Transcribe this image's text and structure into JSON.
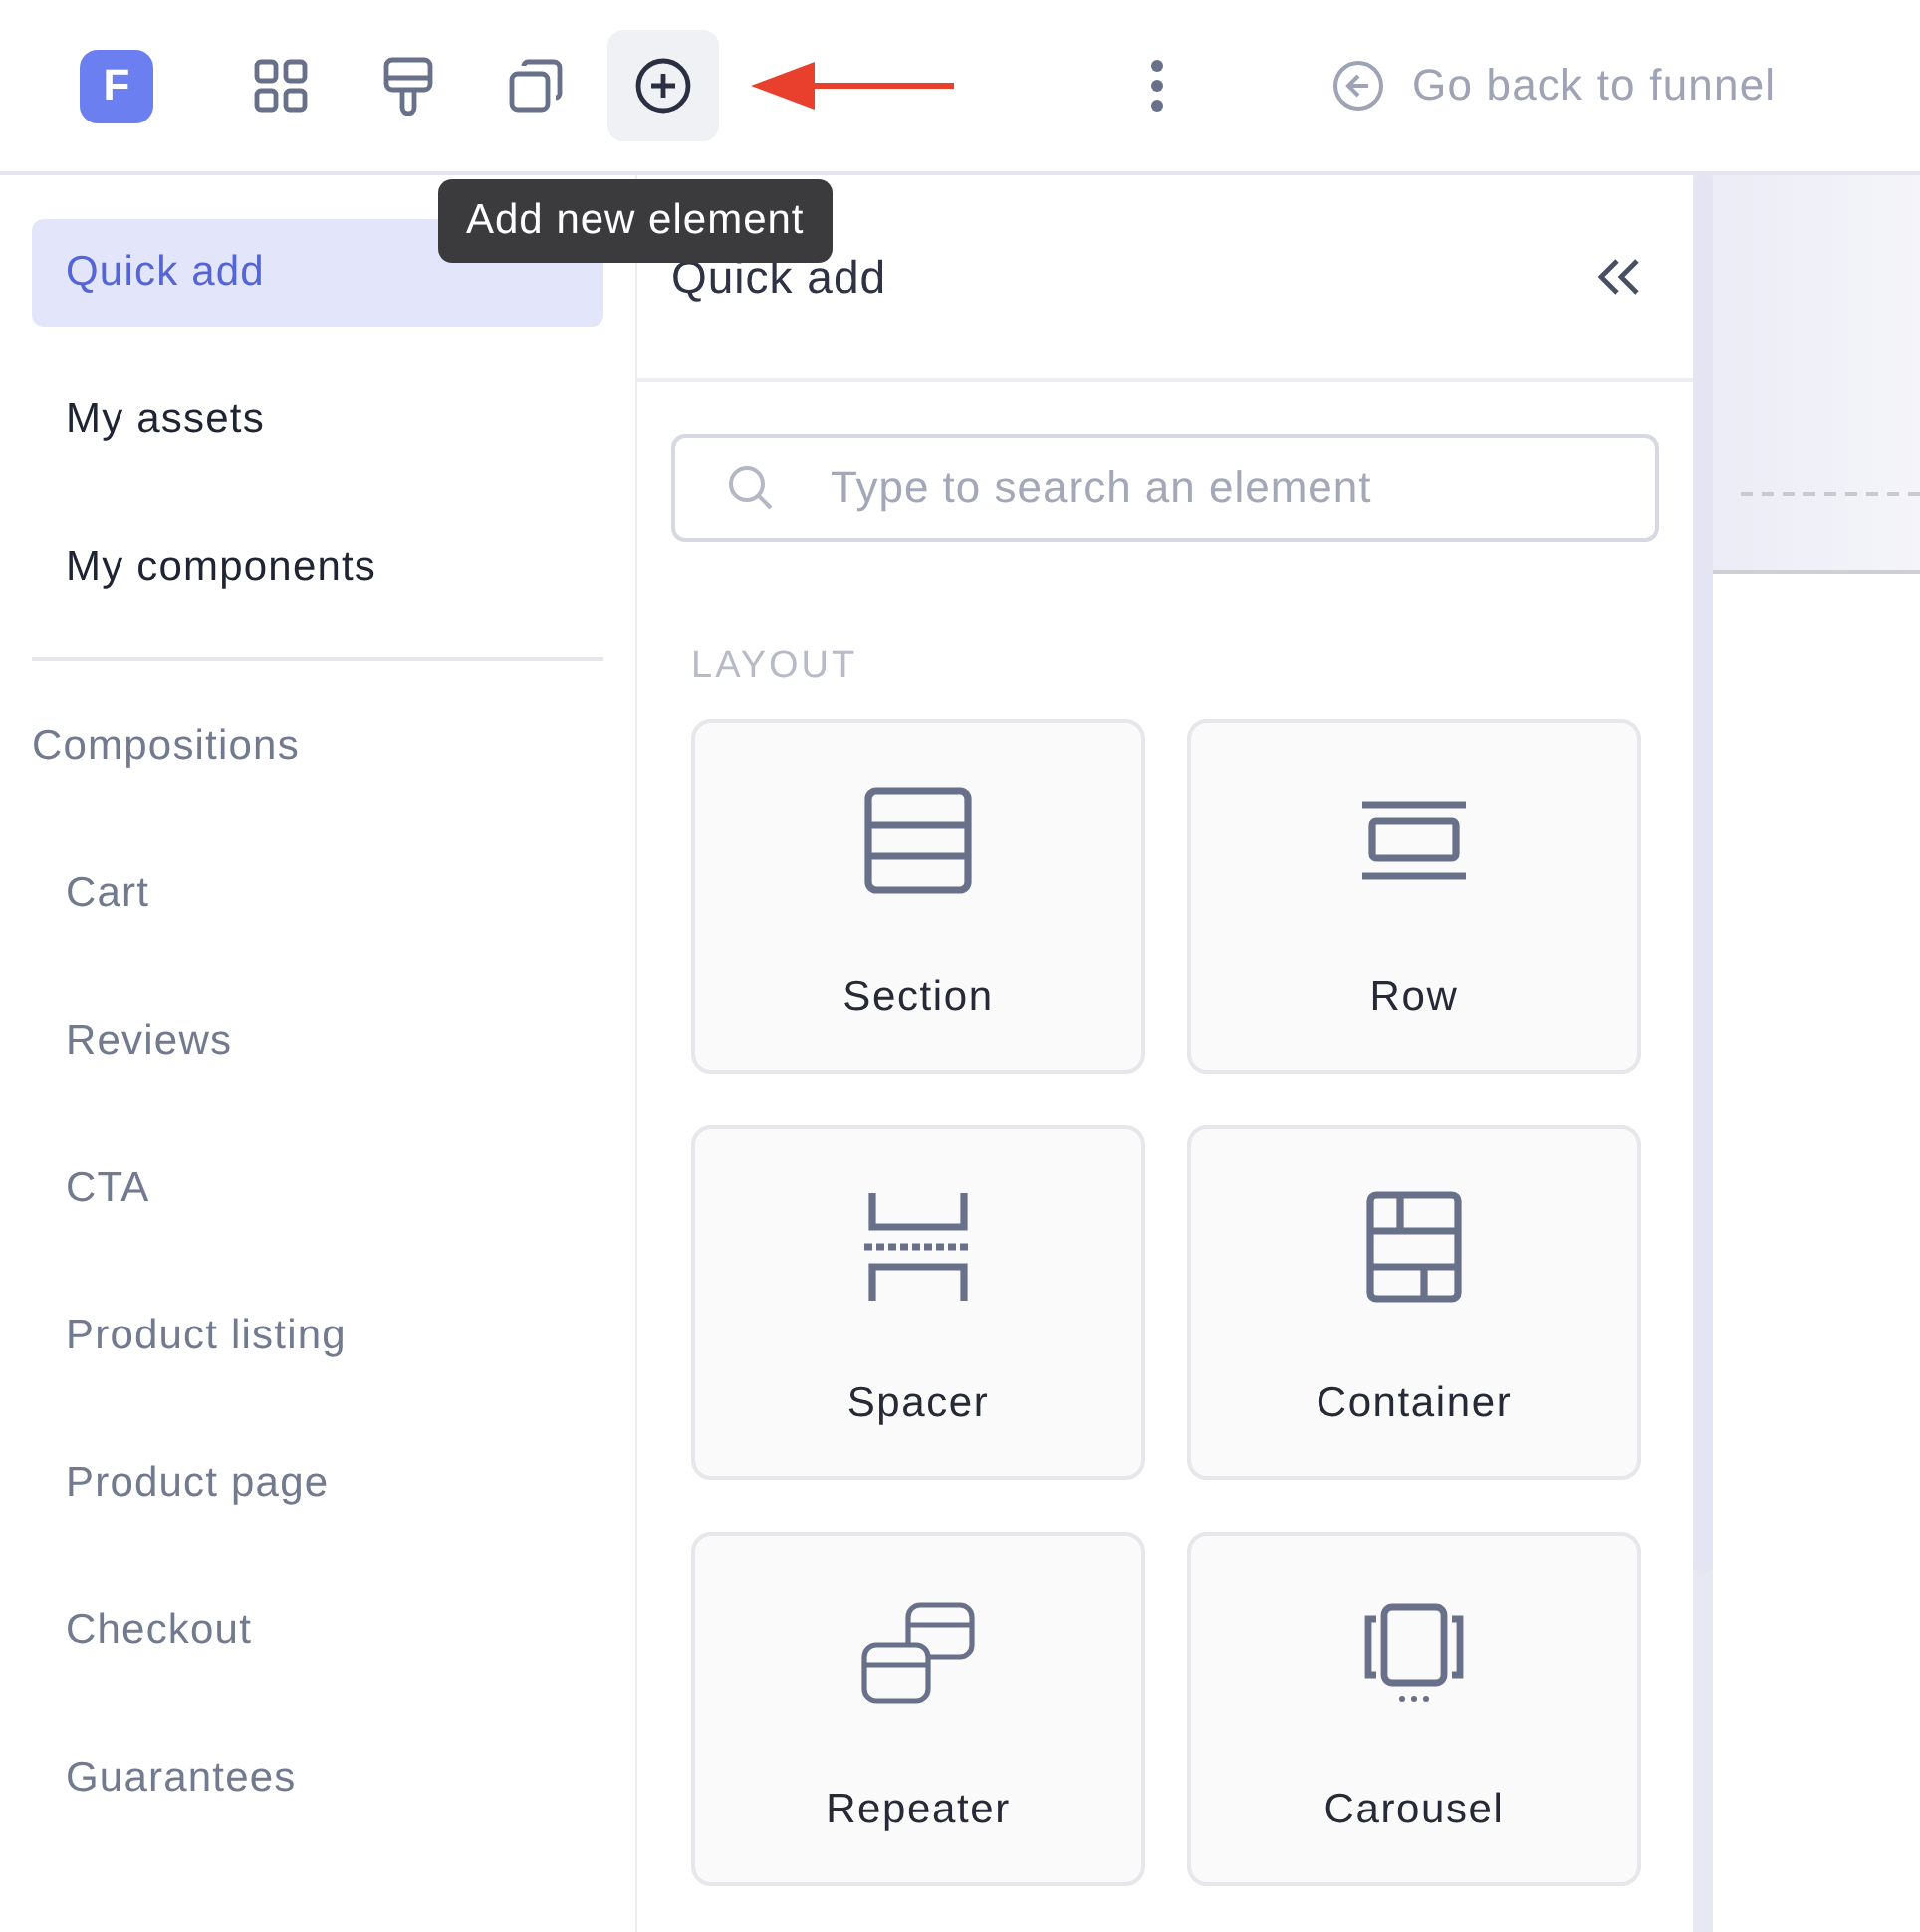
{
  "toolbar": {
    "logo": "F",
    "tools": [
      {
        "kind": "grid",
        "selected": false
      },
      {
        "kind": "brush",
        "selected": false
      },
      {
        "kind": "copy",
        "selected": false
      },
      {
        "kind": "add",
        "selected": true
      }
    ],
    "tooltip": "Add new element",
    "back_link": "Go back to funnel"
  },
  "sidebar": {
    "items": [
      {
        "label": "Quick add",
        "selected": true
      },
      {
        "label": "My assets",
        "selected": false
      },
      {
        "label": "My components",
        "selected": false
      }
    ],
    "group": {
      "label": "Compositions",
      "children": [
        {
          "label": "Cart"
        },
        {
          "label": "Reviews"
        },
        {
          "label": "CTA"
        },
        {
          "label": "Product listing"
        },
        {
          "label": "Product page"
        },
        {
          "label": "Checkout"
        },
        {
          "label": "Guarantees"
        }
      ]
    }
  },
  "panel": {
    "title": "Quick add",
    "search": {
      "placeholder": "Type to search an element"
    },
    "section": "LAYOUT",
    "elements": [
      {
        "kind": "section",
        "label": "Section"
      },
      {
        "kind": "row",
        "label": "Row"
      },
      {
        "kind": "spacer",
        "label": "Spacer"
      },
      {
        "kind": "container",
        "label": "Container"
      },
      {
        "kind": "repeater",
        "label": "Repeater"
      },
      {
        "kind": "carousel",
        "label": "Carousel"
      }
    ]
  }
}
